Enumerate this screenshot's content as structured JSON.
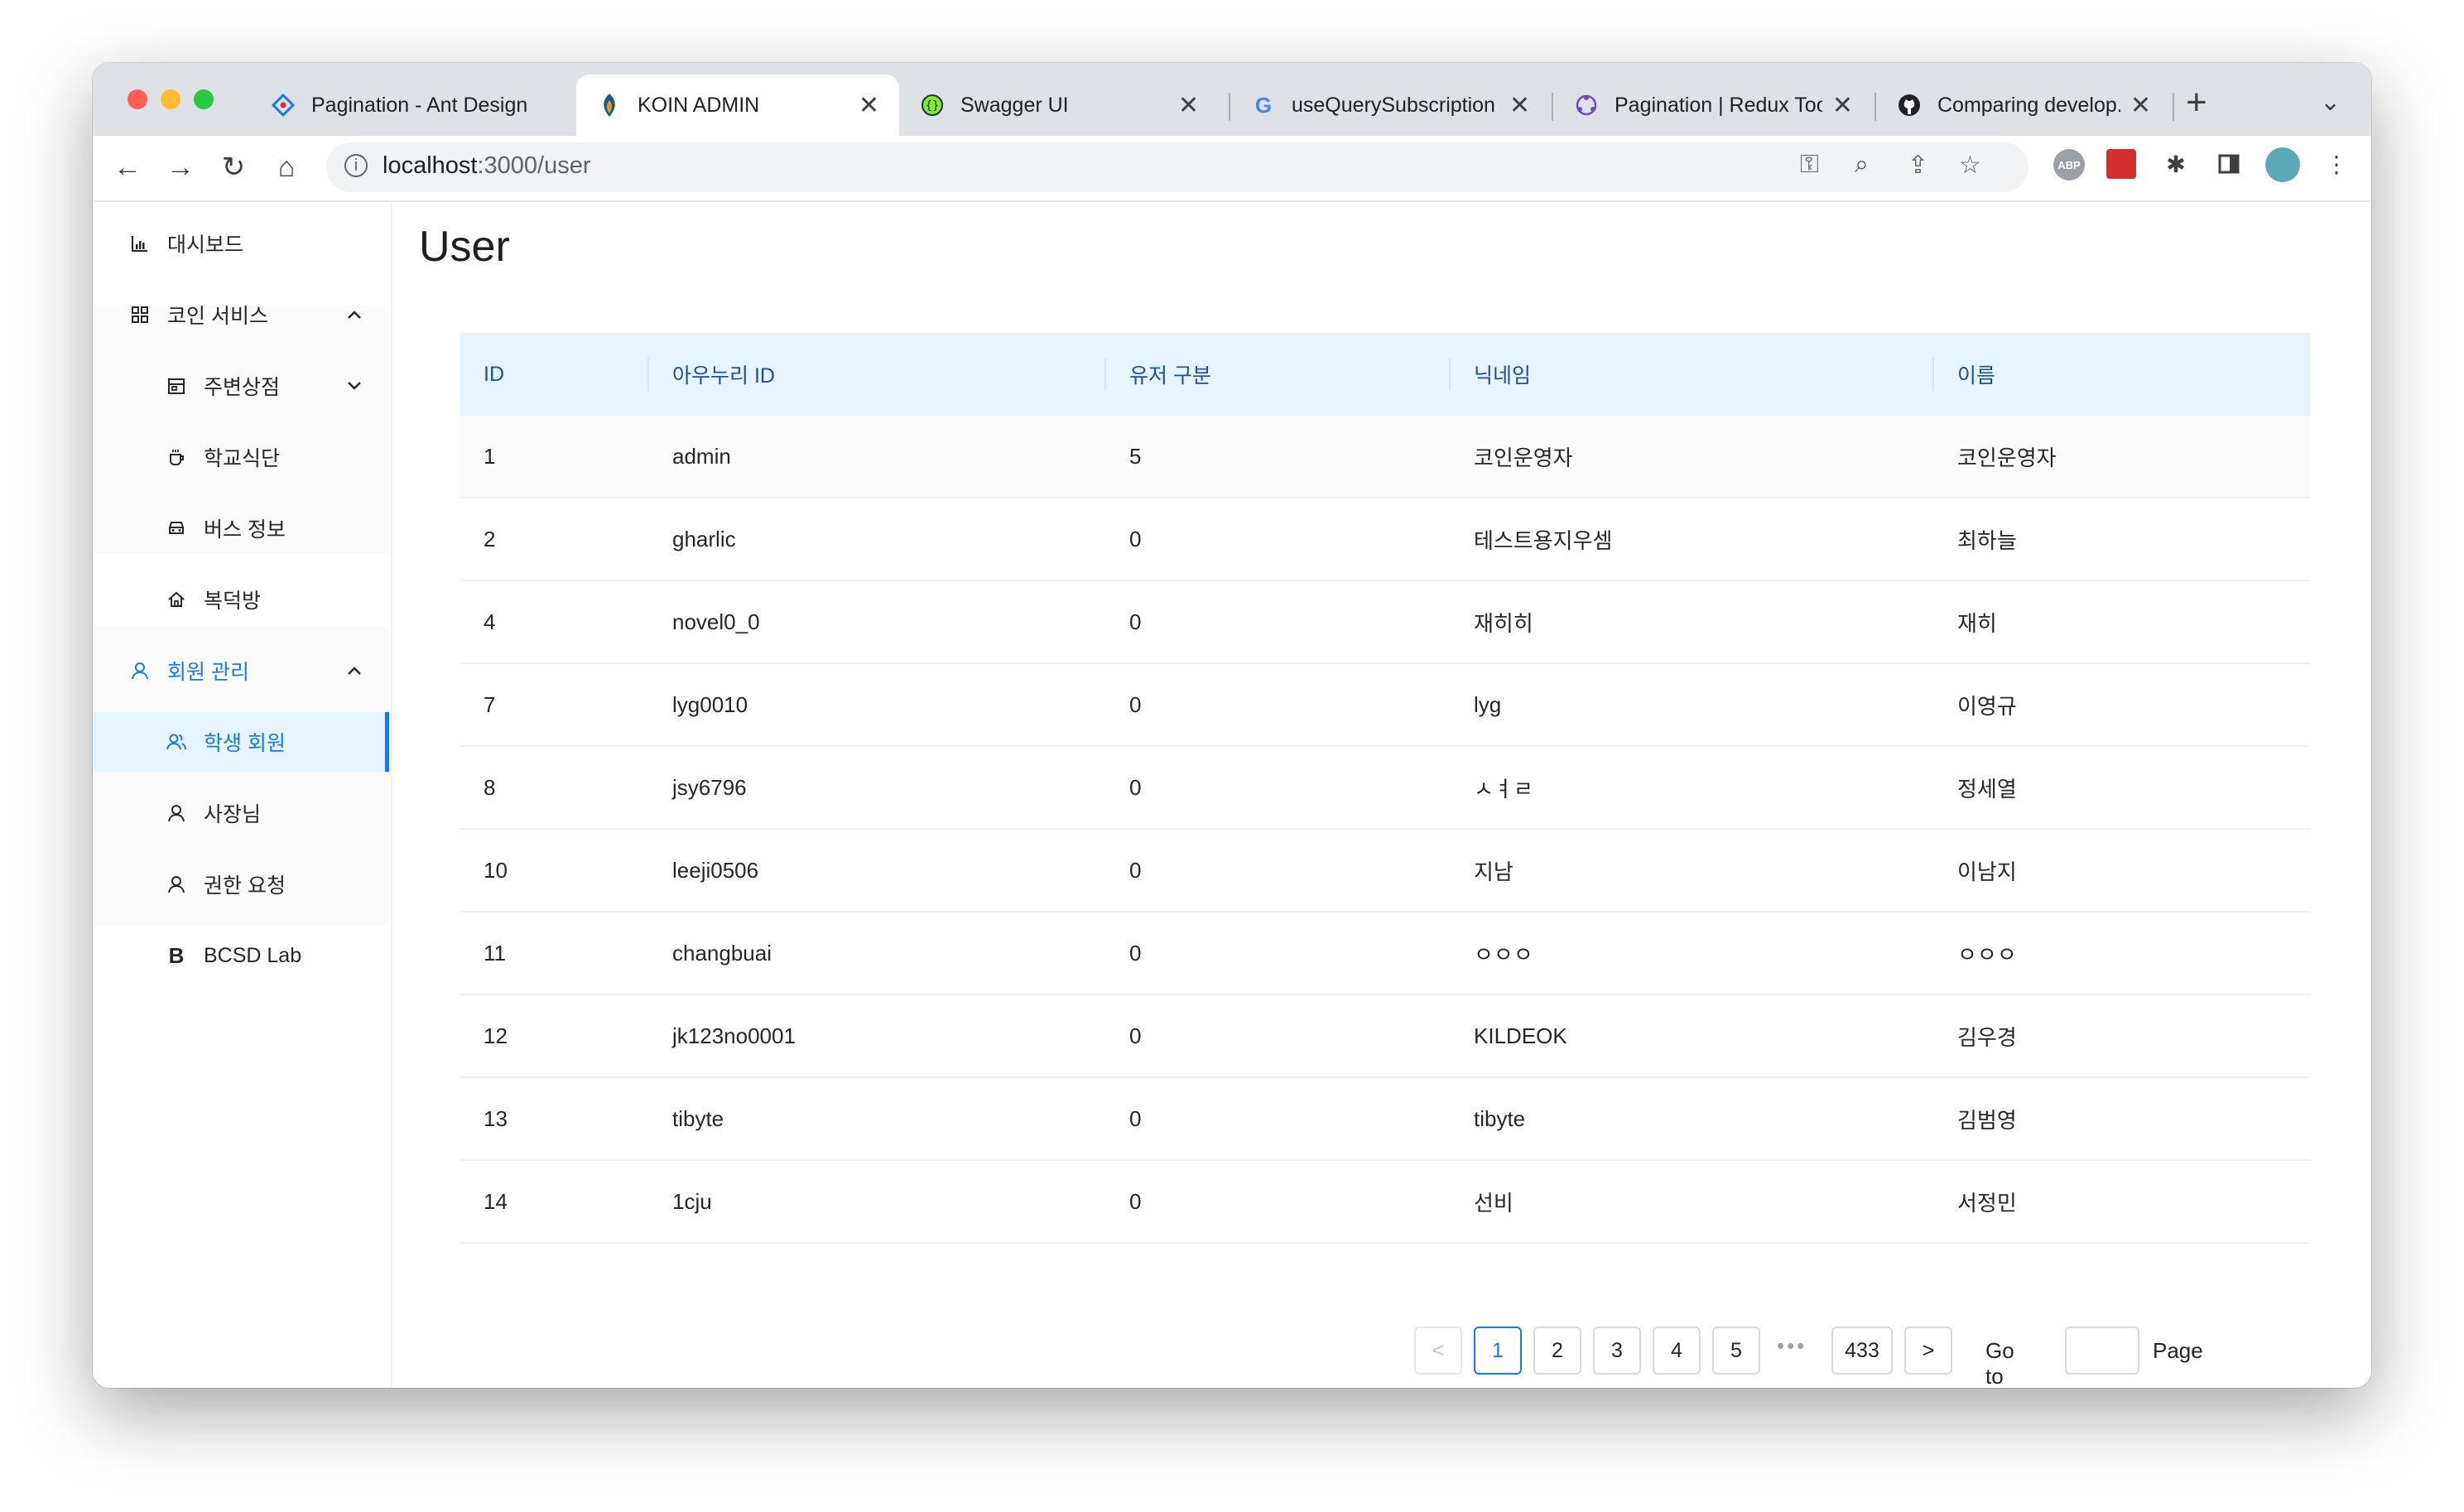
{
  "browser": {
    "tabs": [
      {
        "title": "Pagination - Ant Design",
        "favicon": "ant-design-icon",
        "active": false
      },
      {
        "title": "KOIN ADMIN",
        "favicon": "koin-icon",
        "active": true
      },
      {
        "title": "Swagger UI",
        "favicon": "swagger-icon",
        "active": false
      },
      {
        "title": "useQuerySubscription",
        "favicon": "google-icon",
        "active": false
      },
      {
        "title": "Pagination | Redux Toolkit",
        "favicon": "redux-icon",
        "active": false
      },
      {
        "title": "Comparing develop...feature",
        "favicon": "github-icon",
        "active": false
      }
    ],
    "url_host": "localhost",
    "url_path": ":3000/user"
  },
  "sidebar": {
    "items": [
      {
        "label": "대시보드",
        "icon": "bar-chart-icon"
      },
      {
        "label": "코인 서비스",
        "icon": "grid-icon",
        "arrow": "up"
      },
      {
        "label": "주변상점",
        "icon": "shop-icon",
        "arrow": "down"
      },
      {
        "label": "학교식단",
        "icon": "coffee-icon"
      },
      {
        "label": "버스 정보",
        "icon": "car-icon"
      },
      {
        "label": "복덕방",
        "icon": "home-icon"
      },
      {
        "label": "회원 관리",
        "icon": "user-icon",
        "arrow": "up"
      },
      {
        "label": "학생 회원",
        "icon": "users-icon"
      },
      {
        "label": "사장님",
        "icon": "user-icon"
      },
      {
        "label": "권한 요청",
        "icon": "user-icon"
      },
      {
        "label": "BCSD Lab",
        "icon": "b-icon"
      }
    ]
  },
  "page": {
    "title": "User"
  },
  "table": {
    "columns": [
      "ID",
      "아우누리 ID",
      "유저 구분",
      "닉네임",
      "이름"
    ],
    "rows": [
      [
        "1",
        "admin",
        "5",
        "코인운영자",
        "코인운영자"
      ],
      [
        "2",
        "gharlic",
        "0",
        "테스트용지우셈",
        "최하늘"
      ],
      [
        "4",
        "novel0_0",
        "0",
        "재히히",
        "재히"
      ],
      [
        "7",
        "lyg0010",
        "0",
        "lyg",
        "이영규"
      ],
      [
        "8",
        "jsy6796",
        "0",
        "ㅅㅕㄹ",
        "정세열"
      ],
      [
        "10",
        "leeji0506",
        "0",
        "지남",
        "이남지"
      ],
      [
        "11",
        "changbuai",
        "0",
        "ㅇㅇㅇ",
        "ㅇㅇㅇ"
      ],
      [
        "12",
        "jk123no0001",
        "0",
        "KILDEOK",
        "김우경"
      ],
      [
        "13",
        "tibyte",
        "0",
        "tibyte",
        "김범영"
      ],
      [
        "14",
        "1cju",
        "0",
        "선비",
        "서정민"
      ]
    ]
  },
  "pagination": {
    "prev": "<",
    "pages": [
      "1",
      "2",
      "3",
      "4",
      "5"
    ],
    "current": "1",
    "ellipsis": "•••",
    "last": "433",
    "next": ">",
    "goto_label": "Go to",
    "page_label": "Page"
  },
  "colors": {
    "accent": "#1677ff",
    "header_bg": "#e6f4ff",
    "traffic_red": "#ff5f57",
    "traffic_yellow": "#febc2e",
    "traffic_green": "#28c840"
  }
}
